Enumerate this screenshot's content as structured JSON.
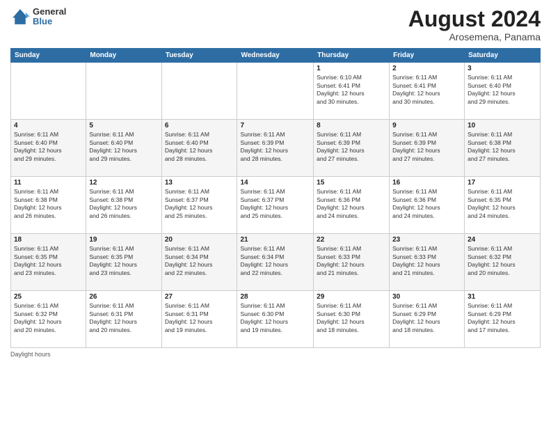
{
  "header": {
    "logo_general": "General",
    "logo_blue": "Blue",
    "month_title": "August 2024",
    "location": "Arosemena, Panama"
  },
  "days_of_week": [
    "Sunday",
    "Monday",
    "Tuesday",
    "Wednesday",
    "Thursday",
    "Friday",
    "Saturday"
  ],
  "weeks": [
    [
      {
        "day": "",
        "info": ""
      },
      {
        "day": "",
        "info": ""
      },
      {
        "day": "",
        "info": ""
      },
      {
        "day": "",
        "info": ""
      },
      {
        "day": "1",
        "info": "Sunrise: 6:10 AM\nSunset: 6:41 PM\nDaylight: 12 hours\nand 30 minutes."
      },
      {
        "day": "2",
        "info": "Sunrise: 6:11 AM\nSunset: 6:41 PM\nDaylight: 12 hours\nand 30 minutes."
      },
      {
        "day": "3",
        "info": "Sunrise: 6:11 AM\nSunset: 6:40 PM\nDaylight: 12 hours\nand 29 minutes."
      }
    ],
    [
      {
        "day": "4",
        "info": "Sunrise: 6:11 AM\nSunset: 6:40 PM\nDaylight: 12 hours\nand 29 minutes."
      },
      {
        "day": "5",
        "info": "Sunrise: 6:11 AM\nSunset: 6:40 PM\nDaylight: 12 hours\nand 29 minutes."
      },
      {
        "day": "6",
        "info": "Sunrise: 6:11 AM\nSunset: 6:40 PM\nDaylight: 12 hours\nand 28 minutes."
      },
      {
        "day": "7",
        "info": "Sunrise: 6:11 AM\nSunset: 6:39 PM\nDaylight: 12 hours\nand 28 minutes."
      },
      {
        "day": "8",
        "info": "Sunrise: 6:11 AM\nSunset: 6:39 PM\nDaylight: 12 hours\nand 27 minutes."
      },
      {
        "day": "9",
        "info": "Sunrise: 6:11 AM\nSunset: 6:39 PM\nDaylight: 12 hours\nand 27 minutes."
      },
      {
        "day": "10",
        "info": "Sunrise: 6:11 AM\nSunset: 6:38 PM\nDaylight: 12 hours\nand 27 minutes."
      }
    ],
    [
      {
        "day": "11",
        "info": "Sunrise: 6:11 AM\nSunset: 6:38 PM\nDaylight: 12 hours\nand 26 minutes."
      },
      {
        "day": "12",
        "info": "Sunrise: 6:11 AM\nSunset: 6:38 PM\nDaylight: 12 hours\nand 26 minutes."
      },
      {
        "day": "13",
        "info": "Sunrise: 6:11 AM\nSunset: 6:37 PM\nDaylight: 12 hours\nand 25 minutes."
      },
      {
        "day": "14",
        "info": "Sunrise: 6:11 AM\nSunset: 6:37 PM\nDaylight: 12 hours\nand 25 minutes."
      },
      {
        "day": "15",
        "info": "Sunrise: 6:11 AM\nSunset: 6:36 PM\nDaylight: 12 hours\nand 24 minutes."
      },
      {
        "day": "16",
        "info": "Sunrise: 6:11 AM\nSunset: 6:36 PM\nDaylight: 12 hours\nand 24 minutes."
      },
      {
        "day": "17",
        "info": "Sunrise: 6:11 AM\nSunset: 6:35 PM\nDaylight: 12 hours\nand 24 minutes."
      }
    ],
    [
      {
        "day": "18",
        "info": "Sunrise: 6:11 AM\nSunset: 6:35 PM\nDaylight: 12 hours\nand 23 minutes."
      },
      {
        "day": "19",
        "info": "Sunrise: 6:11 AM\nSunset: 6:35 PM\nDaylight: 12 hours\nand 23 minutes."
      },
      {
        "day": "20",
        "info": "Sunrise: 6:11 AM\nSunset: 6:34 PM\nDaylight: 12 hours\nand 22 minutes."
      },
      {
        "day": "21",
        "info": "Sunrise: 6:11 AM\nSunset: 6:34 PM\nDaylight: 12 hours\nand 22 minutes."
      },
      {
        "day": "22",
        "info": "Sunrise: 6:11 AM\nSunset: 6:33 PM\nDaylight: 12 hours\nand 21 minutes."
      },
      {
        "day": "23",
        "info": "Sunrise: 6:11 AM\nSunset: 6:33 PM\nDaylight: 12 hours\nand 21 minutes."
      },
      {
        "day": "24",
        "info": "Sunrise: 6:11 AM\nSunset: 6:32 PM\nDaylight: 12 hours\nand 20 minutes."
      }
    ],
    [
      {
        "day": "25",
        "info": "Sunrise: 6:11 AM\nSunset: 6:32 PM\nDaylight: 12 hours\nand 20 minutes."
      },
      {
        "day": "26",
        "info": "Sunrise: 6:11 AM\nSunset: 6:31 PM\nDaylight: 12 hours\nand 20 minutes."
      },
      {
        "day": "27",
        "info": "Sunrise: 6:11 AM\nSunset: 6:31 PM\nDaylight: 12 hours\nand 19 minutes."
      },
      {
        "day": "28",
        "info": "Sunrise: 6:11 AM\nSunset: 6:30 PM\nDaylight: 12 hours\nand 19 minutes."
      },
      {
        "day": "29",
        "info": "Sunrise: 6:11 AM\nSunset: 6:30 PM\nDaylight: 12 hours\nand 18 minutes."
      },
      {
        "day": "30",
        "info": "Sunrise: 6:11 AM\nSunset: 6:29 PM\nDaylight: 12 hours\nand 18 minutes."
      },
      {
        "day": "31",
        "info": "Sunrise: 6:11 AM\nSunset: 6:29 PM\nDaylight: 12 hours\nand 17 minutes."
      }
    ]
  ],
  "footer": {
    "note": "Daylight hours"
  }
}
